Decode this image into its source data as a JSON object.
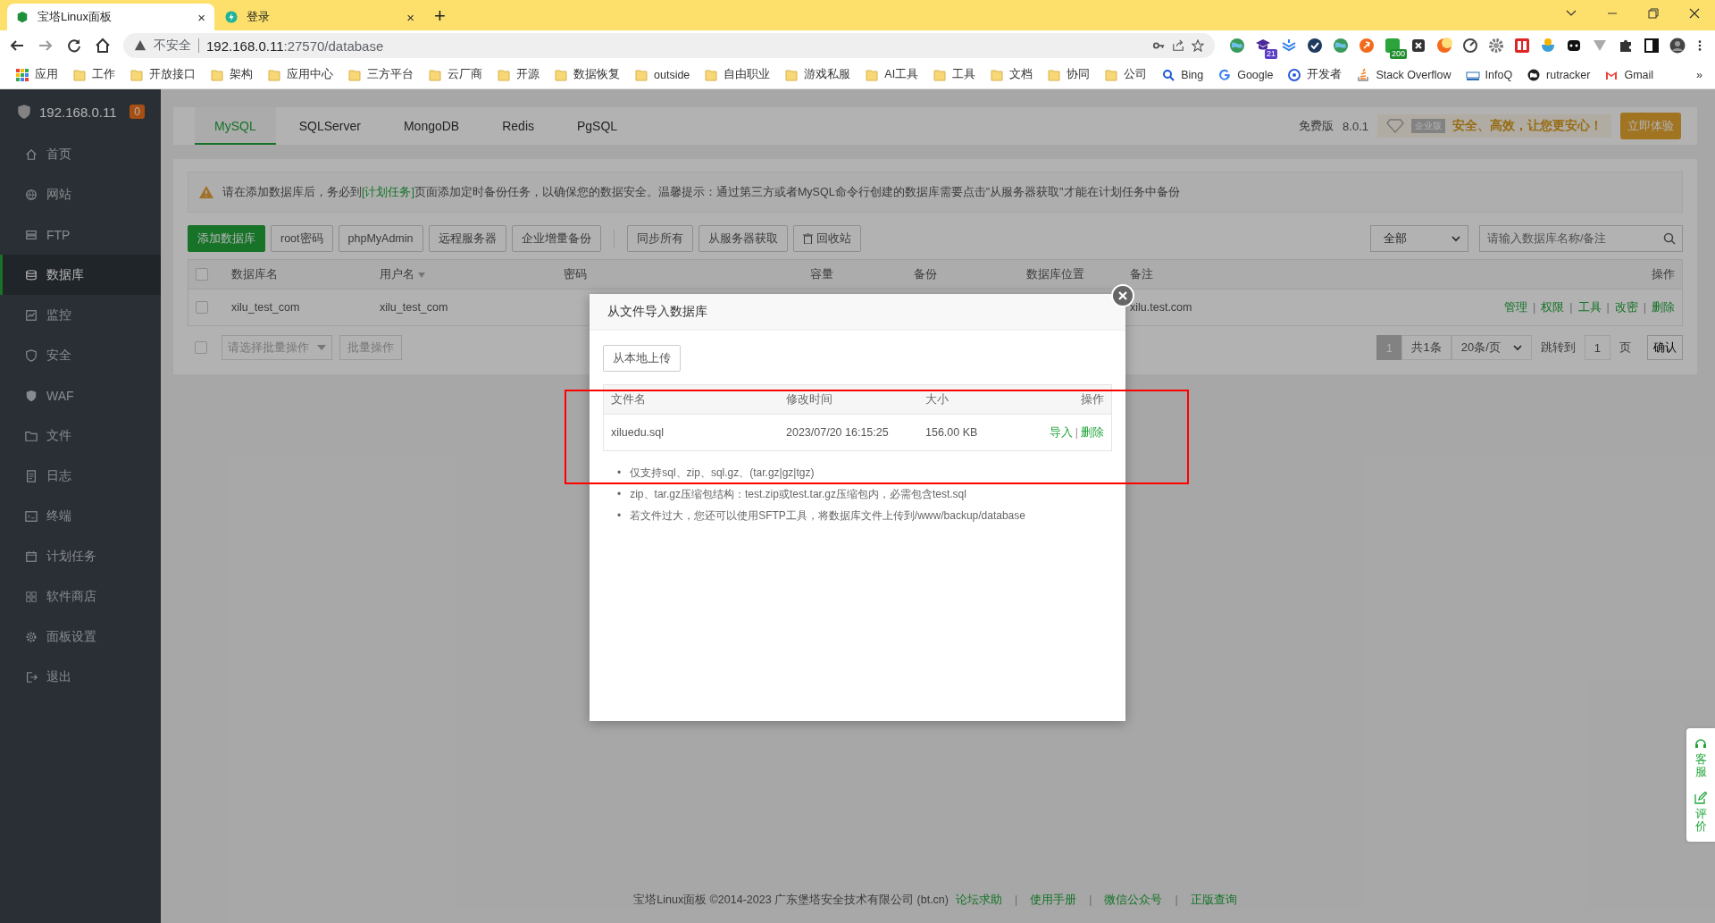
{
  "browser": {
    "tabs": [
      {
        "title": "宝塔Linux面板",
        "selected": true,
        "close": "×"
      },
      {
        "title": "登录",
        "selected": false,
        "close": "×"
      }
    ],
    "new_tab": "+",
    "address": {
      "security": "不安全",
      "url_host": "192.168.0.11",
      "url_rest": ":27570/database"
    },
    "extensions": [
      {
        "kind": "globe"
      },
      {
        "kind": "cap",
        "badge": "21"
      },
      {
        "kind": "layers"
      },
      {
        "kind": "check"
      },
      {
        "kind": "globe"
      },
      {
        "kind": "orange"
      },
      {
        "kind": "green",
        "badge": "200"
      },
      {
        "kind": "x"
      },
      {
        "kind": "moon"
      },
      {
        "kind": "gauge"
      },
      {
        "kind": "gear"
      },
      {
        "kind": "fe"
      },
      {
        "kind": "bowl"
      },
      {
        "kind": "ghost"
      },
      {
        "kind": "v"
      },
      {
        "kind": "puzzle"
      },
      {
        "kind": "panel"
      },
      {
        "kind": "avatar"
      }
    ],
    "bookmarks": [
      {
        "kind": "apps",
        "label": "应用"
      },
      {
        "kind": "folder",
        "label": "工作"
      },
      {
        "kind": "folder",
        "label": "开放接口"
      },
      {
        "kind": "folder",
        "label": "架构"
      },
      {
        "kind": "folder",
        "label": "应用中心"
      },
      {
        "kind": "folder",
        "label": "三方平台"
      },
      {
        "kind": "folder",
        "label": "云厂商"
      },
      {
        "kind": "folder",
        "label": "开源"
      },
      {
        "kind": "folder",
        "label": "数据恢复"
      },
      {
        "kind": "folder",
        "label": "outside"
      },
      {
        "kind": "folder",
        "label": "自由职业"
      },
      {
        "kind": "folder",
        "label": "游戏私服"
      },
      {
        "kind": "folder",
        "label": "AI工具"
      },
      {
        "kind": "folder",
        "label": "工具"
      },
      {
        "kind": "folder",
        "label": "文档"
      },
      {
        "kind": "folder",
        "label": "协同"
      },
      {
        "kind": "folder",
        "label": "公司"
      },
      {
        "kind": "search",
        "label": "Bing"
      },
      {
        "kind": "google",
        "label": "Google"
      },
      {
        "kind": "target",
        "label": "开发者"
      },
      {
        "kind": "stack",
        "label": "Stack Overflow"
      },
      {
        "kind": "infoq",
        "label": "InfoQ"
      },
      {
        "kind": "world",
        "label": "rutracker"
      },
      {
        "kind": "mail",
        "label": "Gmail"
      }
    ],
    "more_bookmarks": "»"
  },
  "sidebar": {
    "host": "192.168.0.11",
    "badge": "0",
    "items": [
      {
        "label": "首页",
        "selected": false
      },
      {
        "label": "网站",
        "selected": false
      },
      {
        "label": "FTP",
        "selected": false
      },
      {
        "label": "数据库",
        "selected": true
      },
      {
        "label": "监控",
        "selected": false
      },
      {
        "label": "安全",
        "selected": false
      },
      {
        "label": "WAF",
        "selected": false
      },
      {
        "label": "文件",
        "selected": false
      },
      {
        "label": "日志",
        "selected": false
      },
      {
        "label": "终端",
        "selected": false
      },
      {
        "label": "计划任务",
        "selected": false
      },
      {
        "label": "软件商店",
        "selected": false
      },
      {
        "label": "面板设置",
        "selected": false
      },
      {
        "label": "退出",
        "selected": false
      }
    ]
  },
  "db_tabs": [
    {
      "label": "MySQL",
      "selected": true
    },
    {
      "label": "SQLServer",
      "selected": false
    },
    {
      "label": "MongoDB",
      "selected": false
    },
    {
      "label": "Redis",
      "selected": false
    },
    {
      "label": "PgSQL",
      "selected": false
    }
  ],
  "edition": "免费版",
  "version": "8.0.1",
  "promo": {
    "badge": "企业版",
    "text": "安全、高效，让您更安心！",
    "button": "立即体验"
  },
  "notice": {
    "text": "请在添加数据库后，务必到**[计划任务]**页面添加定时备份任务，以确保您的数据安全。温馨提示：通过第三方或者MySQL命令行创建的数据库需要点击\"从服务器获取\"才能在计划任务中备份"
  },
  "toolbar": [
    {
      "label": "添加数据库",
      "kind": "primary"
    },
    {
      "label": "root密码",
      "kind": "default"
    },
    {
      "label": "phpMyAdmin",
      "kind": "default"
    },
    {
      "label": "远程服务器",
      "kind": "default"
    },
    {
      "label": "企业增量备份",
      "kind": "default"
    },
    {
      "label": "同步所有",
      "kind": "default"
    },
    {
      "label": "从服务器获取",
      "kind": "default"
    },
    {
      "label": "回收站",
      "kind": "trash"
    }
  ],
  "filter": "全部",
  "search": {
    "placeholder": "请输入数据库名称/备注"
  },
  "table": {
    "select_all_checked": false,
    "separator": "|",
    "columns": [
      "数据库名",
      "用户名",
      "密码",
      "容量",
      "备份",
      "数据库位置",
      "备注",
      "操作"
    ],
    "rows": [
      {
        "checked": false,
        "name": "xilu_test_com",
        "user": "xilu_test_com",
        "note": "xilu.test.com",
        "actions": [
          "管理",
          "权限",
          "工具",
          "改密",
          "删除"
        ]
      }
    ]
  },
  "batch": {
    "checked": false,
    "placeholder": "请选择批量操作",
    "button": "批量操作"
  },
  "pagination": {
    "current": "1",
    "total": "共1条",
    "per_page": "20条/页",
    "jump": "跳转到",
    "page": "1",
    "unit": "页",
    "confirm": "确认"
  },
  "dialog": {
    "title": "从文件导入数据库",
    "separator": "|",
    "bullet": "•",
    "upload": "从本地上传",
    "columns": [
      "文件名",
      "修改时间",
      "大小",
      "操作"
    ],
    "files": [
      {
        "name": "xiluedu.sql",
        "modified": "2023/07/20 16:15:25",
        "size": "156.00 KB",
        "actions": [
          "导入",
          "删除"
        ]
      }
    ],
    "notes": [
      "仅支持sql、zip、sql.gz、(tar.gz|gz|tgz)",
      "zip、tar.gz压缩包结构：test.zip或test.tar.gz压缩包内，必需包含test.sql",
      "若文件过大，您还可以使用SFTP工具，将数据库文件上传到/www/backup/database"
    ]
  },
  "footer": {
    "separator": "|",
    "copyright": "宝塔Linux面板 ©2014-2023 广东堡塔安全技术有限公司 (bt.cn)",
    "links": [
      "论坛求助",
      "使用手册",
      "微信公众号",
      "正版查询"
    ]
  },
  "float_buttons": [
    "客服",
    "评价"
  ]
}
